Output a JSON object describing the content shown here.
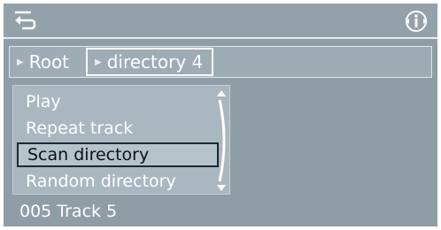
{
  "header": {
    "back_icon": "back-arrow-icon",
    "info_icon": "info-circle-icon"
  },
  "breadcrumb": [
    {
      "label": "Root"
    },
    {
      "label": "directory 4"
    }
  ],
  "menu": {
    "items": [
      {
        "label": "Play"
      },
      {
        "label": "Repeat track"
      },
      {
        "label": "Scan directory",
        "selected": true
      },
      {
        "label": "Random directory"
      }
    ]
  },
  "status": {
    "track": "005 Track 5"
  },
  "colors": {
    "background": "#8f9da6",
    "highlight_border": "#1e2830",
    "text": "#ffffff"
  }
}
